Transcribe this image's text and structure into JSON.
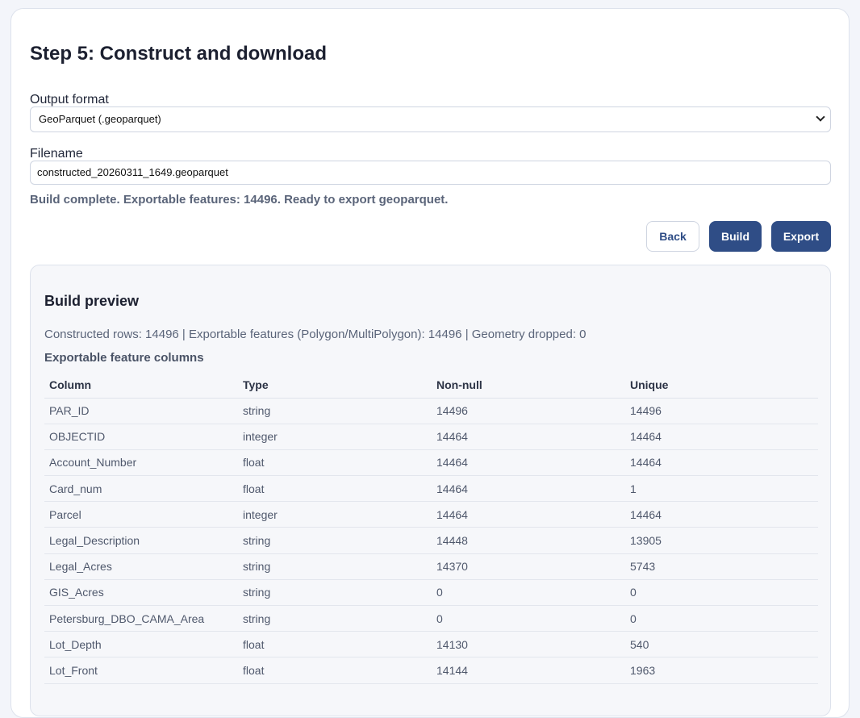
{
  "page": {
    "title": "Step 5: Construct and download",
    "output_format_label": "Output format",
    "output_format_value": "GeoParquet (.geoparquet)",
    "filename_label": "Filename",
    "filename_value": "constructed_20260311_1649.geoparquet",
    "status": "Build complete. Exportable features: 14496. Ready to export geoparquet."
  },
  "actions": {
    "back": "Back",
    "build": "Build",
    "export": "Export"
  },
  "preview": {
    "title": "Build preview",
    "summary": "Constructed rows: 14496 | Exportable features (Polygon/MultiPolygon): 14496 | Geometry dropped: 0",
    "subhead": "Exportable feature columns",
    "headers": [
      "Column",
      "Type",
      "Non-null",
      "Unique"
    ],
    "rows": [
      [
        "PAR_ID",
        "string",
        "14496",
        "14496"
      ],
      [
        "OBJECTID",
        "integer",
        "14464",
        "14464"
      ],
      [
        "Account_Number",
        "float",
        "14464",
        "14464"
      ],
      [
        "Card_num",
        "float",
        "14464",
        "1"
      ],
      [
        "Parcel",
        "integer",
        "14464",
        "14464"
      ],
      [
        "Legal_Description",
        "string",
        "14448",
        "13905"
      ],
      [
        "Legal_Acres",
        "string",
        "14370",
        "5743"
      ],
      [
        "GIS_Acres",
        "string",
        "0",
        "0"
      ],
      [
        "Petersburg_DBO_CAMA_Area",
        "string",
        "0",
        "0"
      ],
      [
        "Lot_Depth",
        "float",
        "14130",
        "540"
      ],
      [
        "Lot_Front",
        "float",
        "14144",
        "1963"
      ]
    ]
  },
  "colors": {
    "primary": "#2f4d86",
    "background": "#f3f5fa"
  }
}
